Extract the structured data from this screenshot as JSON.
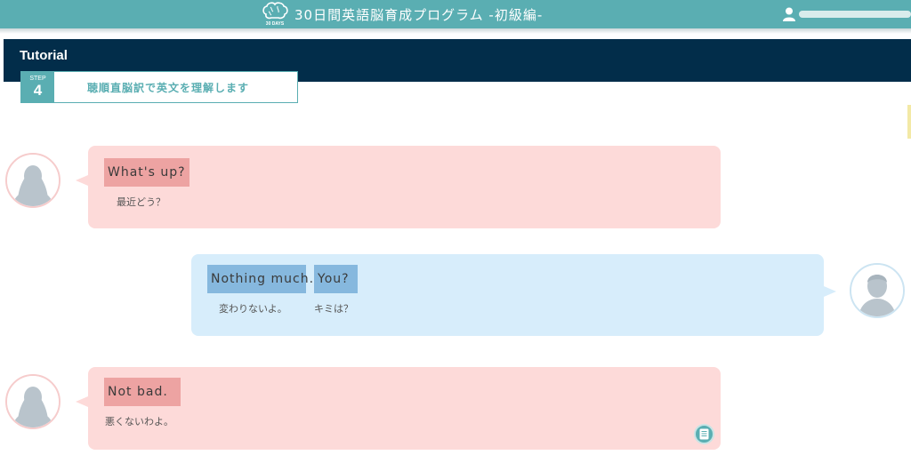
{
  "header": {
    "logo_text": "30 DAYS",
    "app_title": "30日間英語脳育成プログラム -初級編-",
    "user_name": ""
  },
  "tutorial": {
    "title": "Tutorial",
    "step_word": "STEP",
    "step_number": "4",
    "step_label": "聴順直脳訳で英文を理解します"
  },
  "dialogue": [
    {
      "speaker": "female",
      "chunks": [
        {
          "en": "What's up?",
          "ja": "最近どう？"
        }
      ]
    },
    {
      "speaker": "male",
      "chunks": [
        {
          "en": "Nothing much.",
          "ja": "変わりないよ。"
        },
        {
          "en": "You?",
          "ja": "キミは？"
        }
      ]
    },
    {
      "speaker": "female",
      "chunks": [
        {
          "en": "Not bad.",
          "ja": "悪くないわよ。"
        }
      ]
    }
  ],
  "icons": {
    "logo": "brain-logo-icon",
    "user": "user-icon",
    "memo": "memo-icon",
    "avatar_female": "female-avatar-icon",
    "avatar_male": "male-avatar-icon"
  },
  "colors": {
    "accent": "#5aaeb2",
    "navy": "#022d4a",
    "pink_bubble": "#fddad9",
    "pink_chip": "#eda3a2",
    "blue_bubble": "#d7edfb",
    "blue_chip": "#86b8de"
  }
}
